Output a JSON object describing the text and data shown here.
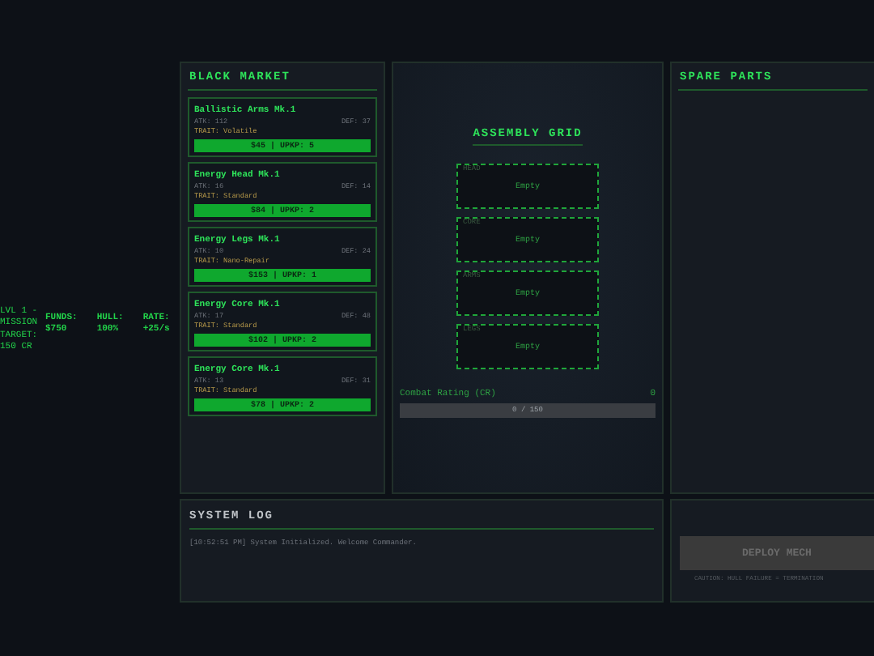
{
  "status": {
    "mission": "LVL 1 - MISSION TARGET: 150 CR",
    "stats": [
      {
        "label": "FUNDS:",
        "value": "$750"
      },
      {
        "label": "HULL:",
        "value": "100%"
      },
      {
        "label": "RATE:",
        "value": "+25/s"
      }
    ]
  },
  "market": {
    "title": "BLACK MARKET",
    "items": [
      {
        "name": "Ballistic Arms Mk.1",
        "atk": "ATK: 112",
        "def": "DEF: 37",
        "trait": "TRAIT: Volatile",
        "price": "$45 | UPKP: 5"
      },
      {
        "name": "Energy Head Mk.1",
        "atk": "ATK: 16",
        "def": "DEF: 14",
        "trait": "TRAIT: Standard",
        "price": "$84 | UPKP: 2"
      },
      {
        "name": "Energy Legs Mk.1",
        "atk": "ATK: 10",
        "def": "DEF: 24",
        "trait": "TRAIT: Nano-Repair",
        "price": "$153 | UPKP: 1"
      },
      {
        "name": "Energy Core Mk.1",
        "atk": "ATK: 17",
        "def": "DEF: 48",
        "trait": "TRAIT: Standard",
        "price": "$102 | UPKP: 2"
      },
      {
        "name": "Energy Core Mk.1",
        "atk": "ATK: 13",
        "def": "DEF: 31",
        "trait": "TRAIT: Standard",
        "price": "$78 | UPKP: 2"
      }
    ]
  },
  "assembly": {
    "title": "ASSEMBLY GRID",
    "slots": [
      {
        "label": "HEAD",
        "content": "Empty"
      },
      {
        "label": "CORE",
        "content": "Empty"
      },
      {
        "label": "ARMS",
        "content": "Empty"
      },
      {
        "label": "LEGS",
        "content": "Empty"
      }
    ],
    "rating": {
      "label": "Combat Rating (CR)",
      "value": "0",
      "level": 0,
      "reading": "0 / 150"
    }
  },
  "spare": {
    "title": "SPARE PARTS"
  },
  "log": {
    "title": "SYSTEM LOG",
    "entries": [
      "[10:52:51 PM] System Initialized. Welcome Commander."
    ]
  },
  "deploy": {
    "label": "DEPLOY MECH",
    "disabled": true,
    "caution": "CAUTION: HULL FAILURE = TERMINATION"
  }
}
